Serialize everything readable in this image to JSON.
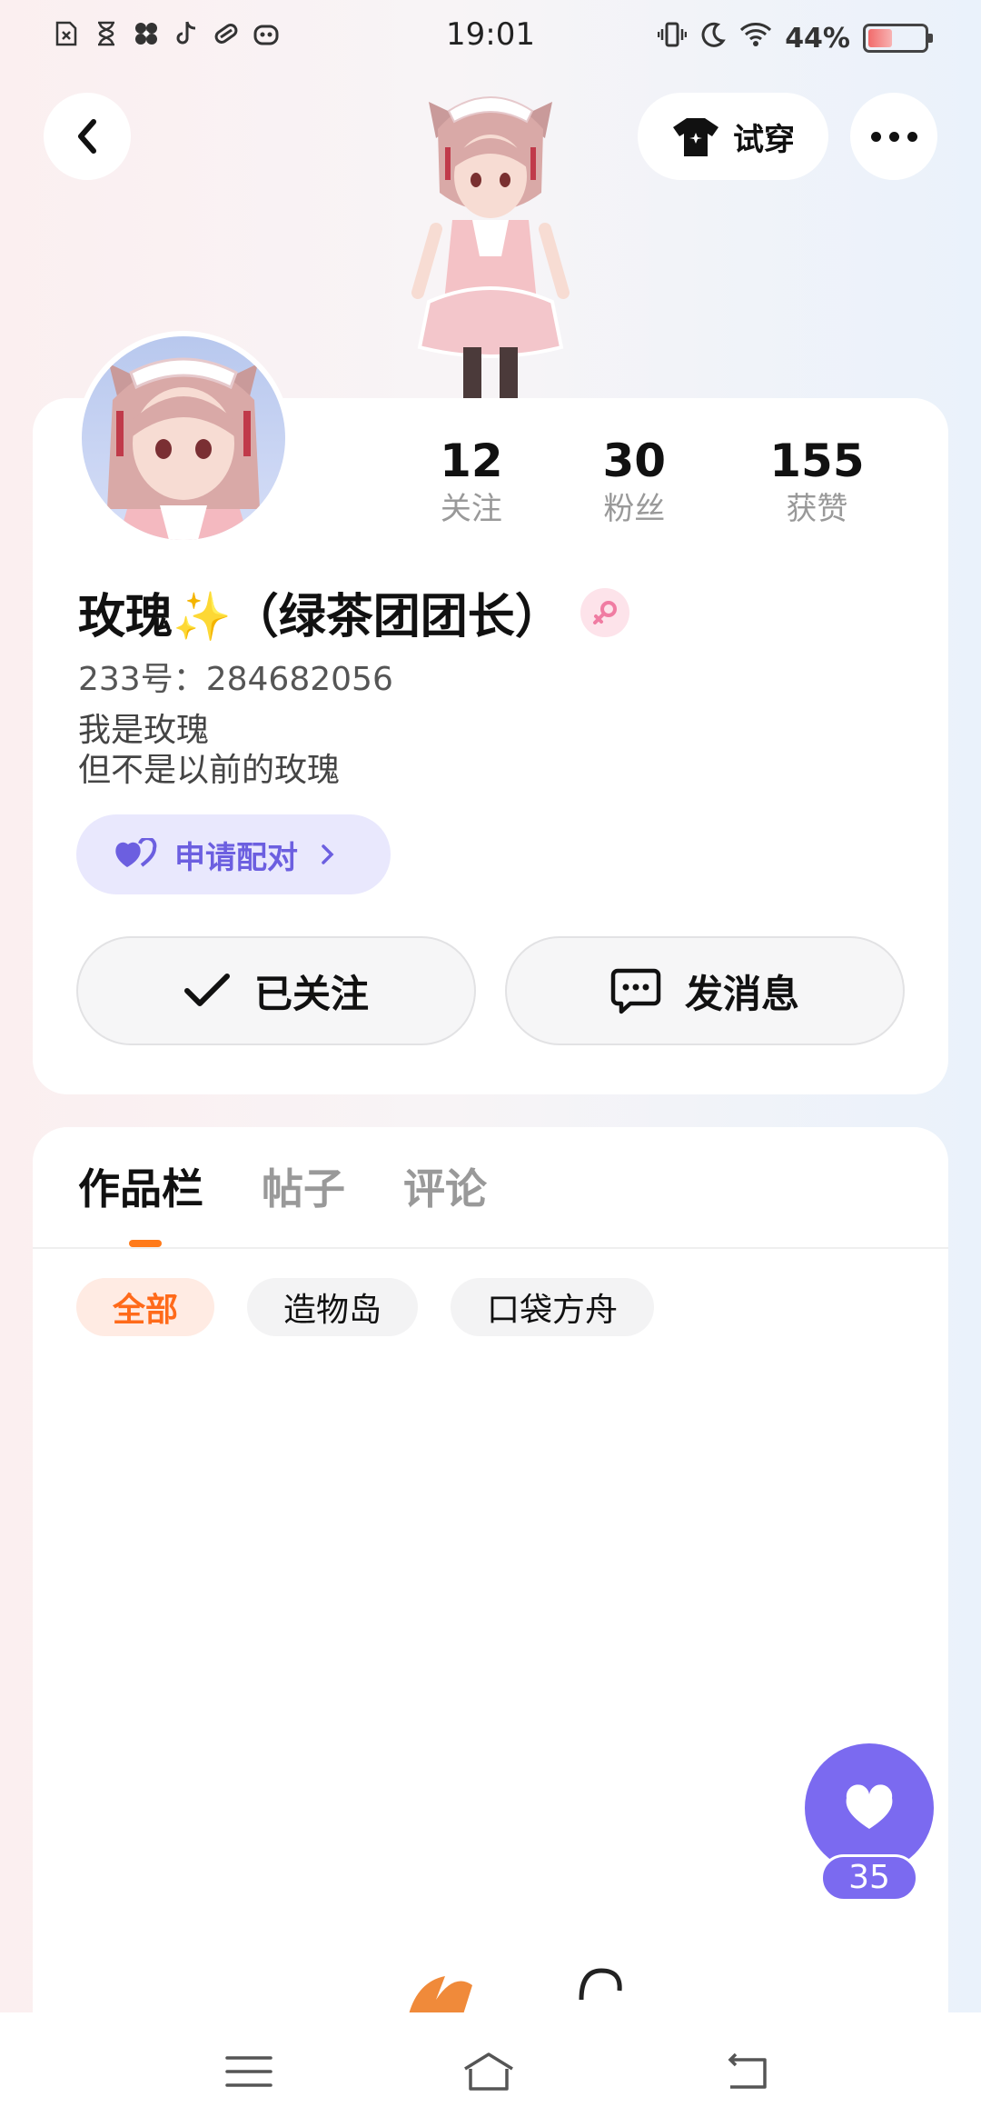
{
  "status_bar": {
    "time": "19:01",
    "battery": "44%",
    "battery_level": 0.44,
    "left_icons": [
      "sim-off-icon",
      "hourglass-icon",
      "fan-icon",
      "tiktok-icon",
      "capsule-icon",
      "robot-icon"
    ],
    "right_icons": [
      "vibrate-icon",
      "moon-icon",
      "wifi-icon",
      "battery-icon"
    ]
  },
  "header": {
    "tryon_label": "试穿"
  },
  "profile": {
    "stats": [
      {
        "value": "12",
        "label": "关注"
      },
      {
        "value": "30",
        "label": "粉丝"
      },
      {
        "value": "155",
        "label": "获赞"
      }
    ],
    "name": "玫瑰✨（绿茶团团长）",
    "gender": "female",
    "uid": "233号：284682056",
    "bio_line1": "我是玫瑰",
    "bio_line2": "但不是以前的玫瑰",
    "pair_label": "申请配对",
    "follow_label": "已关注",
    "message_label": "发消息"
  },
  "tabs": [
    {
      "label": "作品栏",
      "active": true
    },
    {
      "label": "帖子",
      "active": false
    },
    {
      "label": "评论",
      "active": false
    }
  ],
  "chips": [
    {
      "label": "全部",
      "active": true
    },
    {
      "label": "造物岛",
      "active": false
    },
    {
      "label": "口袋方舟",
      "active": false
    }
  ],
  "like": {
    "count": "35"
  },
  "colors": {
    "accent_purple": "#7b6af0",
    "accent_orange": "#ff6a1a",
    "gender_pink": "#f07ca2"
  }
}
